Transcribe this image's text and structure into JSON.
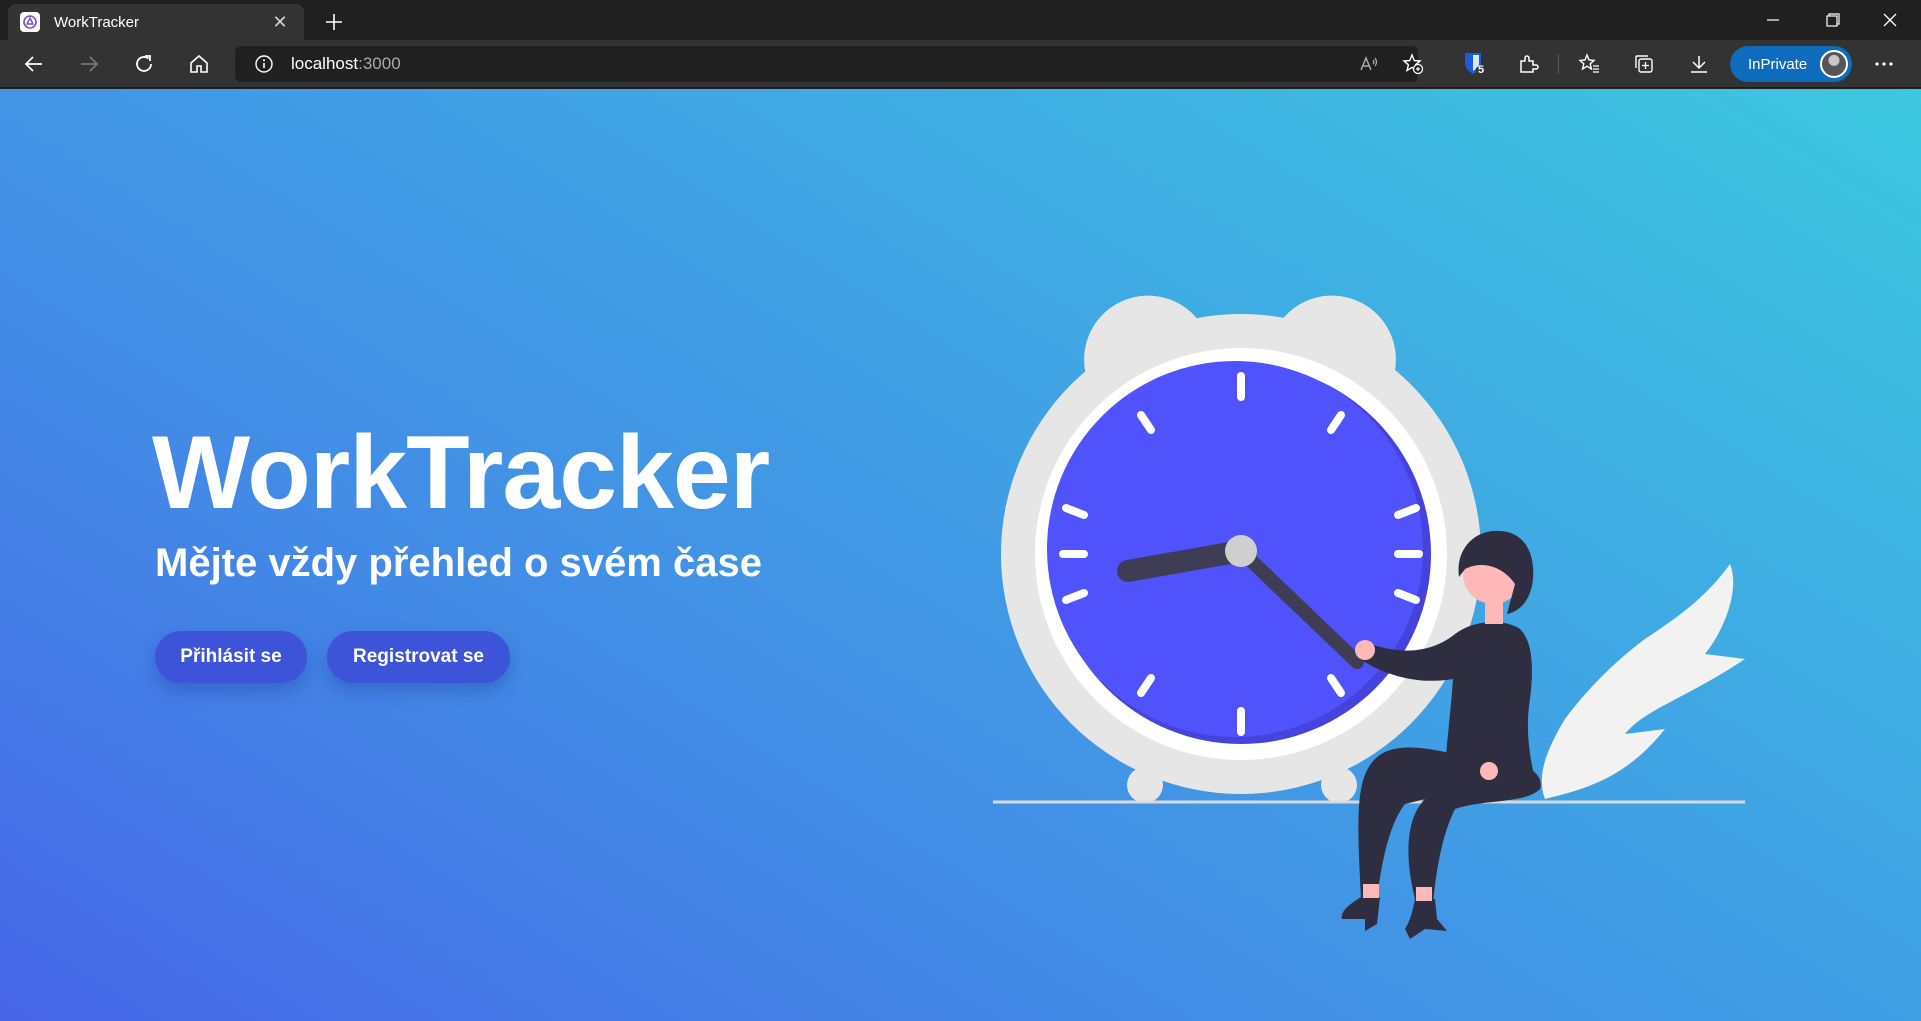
{
  "browser": {
    "tab": {
      "title": "WorkTracker"
    },
    "address": {
      "host": "localhost",
      "port": ":3000"
    },
    "extension_badge": "5",
    "inprivate_label": "InPrivate"
  },
  "hero": {
    "title": "WorkTracker",
    "subtitle": "Mějte vždy přehled o svém čase",
    "login_label": "Přihlásit se",
    "register_label": "Registrovat se"
  },
  "colors": {
    "accent_button": "#3d53d8",
    "clock_face": "#5053fc",
    "gradient_top": "#3cc8df",
    "gradient_bottom": "#4766e8"
  },
  "icons": [
    "back-icon",
    "forward-icon",
    "refresh-icon",
    "home-icon",
    "info-icon",
    "read-aloud-icon",
    "add-favorite-icon",
    "bitwarden-icon",
    "extensions-icon",
    "favorites-icon",
    "collections-icon",
    "downloads-icon",
    "more-icon",
    "minimize-icon",
    "restore-icon",
    "close-icon"
  ]
}
